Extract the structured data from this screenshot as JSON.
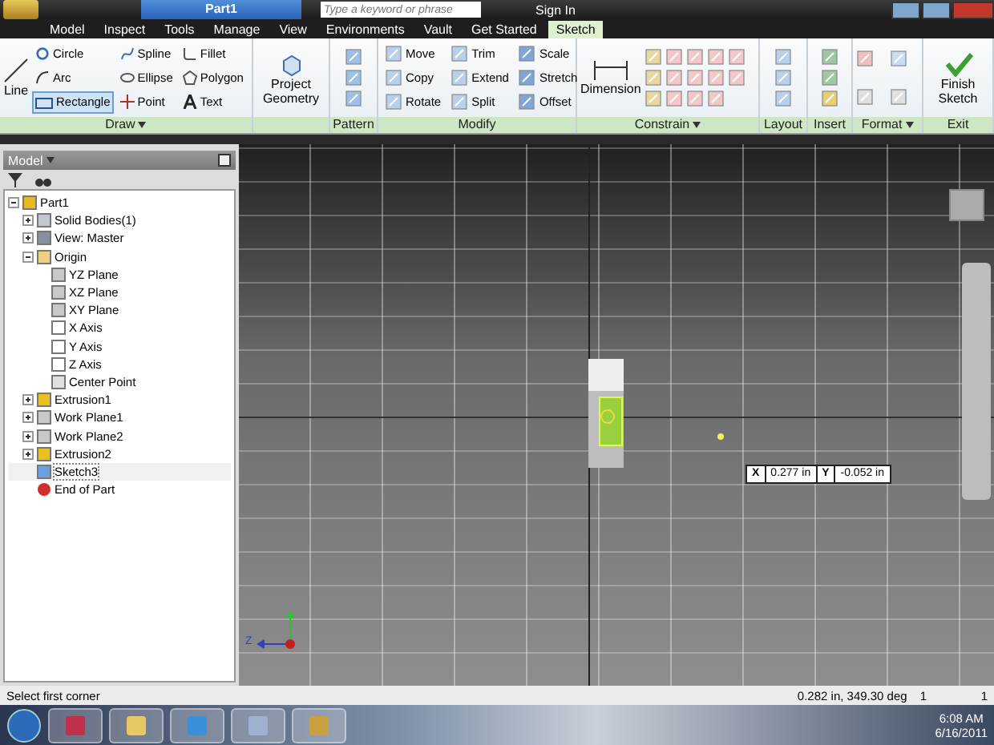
{
  "window": {
    "title": "Part1",
    "search_placeholder": "Type a keyword or phrase",
    "sign_in": "Sign In"
  },
  "menu_tabs": [
    {
      "label": "Model",
      "selected": false
    },
    {
      "label": "Inspect",
      "selected": false
    },
    {
      "label": "Tools",
      "selected": false
    },
    {
      "label": "Manage",
      "selected": false
    },
    {
      "label": "View",
      "selected": false
    },
    {
      "label": "Environments",
      "selected": false
    },
    {
      "label": "Vault",
      "selected": false
    },
    {
      "label": "Get Started",
      "selected": false
    },
    {
      "label": "Sketch",
      "selected": true
    }
  ],
  "ribbon": {
    "draw": {
      "label": "Draw",
      "line": "Line",
      "tools": [
        {
          "label": "Circle",
          "kind": "circle",
          "selected": false
        },
        {
          "label": "Spline",
          "kind": "spline",
          "selected": false
        },
        {
          "label": "Fillet",
          "kind": "fillet",
          "selected": false
        },
        {
          "label": "Arc",
          "kind": "arc",
          "selected": false
        },
        {
          "label": "Ellipse",
          "kind": "ellipse",
          "selected": false
        },
        {
          "label": "Polygon",
          "kind": "polygon",
          "selected": false
        },
        {
          "label": "Rectangle",
          "kind": "rectangle",
          "selected": true
        },
        {
          "label": "Point",
          "kind": "point",
          "selected": false
        },
        {
          "label": "Text",
          "kind": "text",
          "selected": false
        }
      ]
    },
    "project_geometry": [
      "Project",
      "Geometry"
    ],
    "pattern": {
      "label": "Pattern"
    },
    "modify": {
      "label": "Modify",
      "tools": [
        "Move",
        "Trim",
        "Scale",
        "Copy",
        "Extend",
        "Stretch",
        "Rotate",
        "Split",
        "Offset"
      ]
    },
    "constrain": {
      "label": "Constrain",
      "dimension": "Dimension"
    },
    "layout": {
      "label": "Layout"
    },
    "insert": {
      "label": "Insert"
    },
    "format": {
      "label": "Format"
    },
    "exit": {
      "label": "Exit",
      "finish": [
        "Finish",
        "Sketch"
      ]
    }
  },
  "browser": {
    "title": "Model",
    "tree": [
      {
        "label": "Part1",
        "kind": "part",
        "expanded": true,
        "selected": false,
        "children": [
          {
            "label": "Solid Bodies(1)",
            "kind": "bodies",
            "expanded": false,
            "selected": false
          },
          {
            "label": "View: Master",
            "kind": "view",
            "expanded": false,
            "selected": false
          },
          {
            "label": "Origin",
            "kind": "folder",
            "expanded": true,
            "selected": false,
            "children": [
              {
                "label": "YZ Plane",
                "kind": "plane",
                "selected": false
              },
              {
                "label": "XZ Plane",
                "kind": "plane",
                "selected": false
              },
              {
                "label": "XY Plane",
                "kind": "plane",
                "selected": false
              },
              {
                "label": "X Axis",
                "kind": "axis",
                "selected": false
              },
              {
                "label": "Y Axis",
                "kind": "axis",
                "selected": false
              },
              {
                "label": "Z Axis",
                "kind": "axis",
                "selected": false
              },
              {
                "label": "Center Point",
                "kind": "point",
                "selected": false
              }
            ]
          },
          {
            "label": "Extrusion1",
            "kind": "feature",
            "expanded": false,
            "selected": false
          },
          {
            "label": "Work Plane1",
            "kind": "plane",
            "expanded": false,
            "selected": false
          },
          {
            "label": "Work Plane2",
            "kind": "plane",
            "expanded": false,
            "selected": false
          },
          {
            "label": "Extrusion2",
            "kind": "feature",
            "expanded": false,
            "selected": false
          },
          {
            "label": "Sketch3",
            "kind": "sketch",
            "selected": true
          },
          {
            "label": "End of Part",
            "kind": "end",
            "selected": false
          }
        ]
      }
    ]
  },
  "coordinate_input": {
    "x_label": "X",
    "x_value": "0.277 in",
    "y_label": "Y",
    "y_value": "-0.052 in"
  },
  "triad": {
    "z_label": "Z"
  },
  "status_bar": {
    "prompt": "Select first corner",
    "readout": "0.282 in, 349.30 deg",
    "field_1": "1",
    "field_2": "1"
  },
  "taskbar": {
    "time": "6:08 AM",
    "date": "6/16/2011"
  }
}
